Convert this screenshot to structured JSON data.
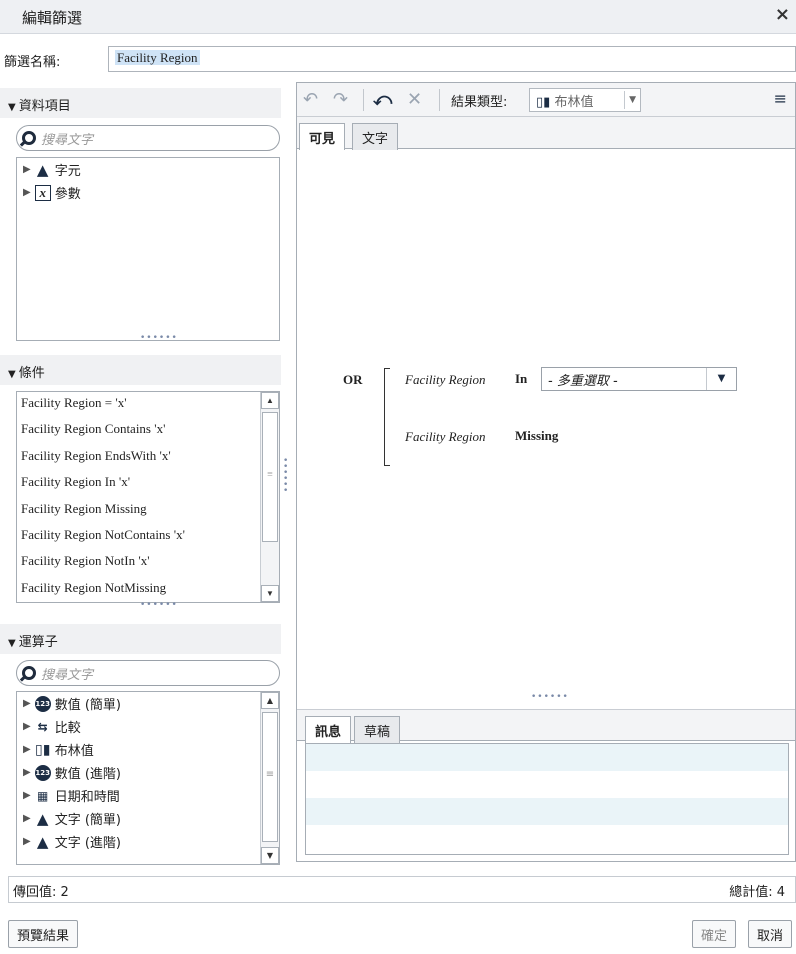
{
  "dialog": {
    "title": "編輯篩選",
    "close_glyph": "×"
  },
  "filter_name": {
    "label": "篩選名稱:",
    "value": "Facility Region"
  },
  "data_items": {
    "header": "資料項目",
    "search_placeholder": "搜尋文字",
    "items": [
      {
        "label": "字元",
        "icon": "character-icon"
      },
      {
        "label": "參數",
        "icon": "parameter-icon"
      }
    ]
  },
  "conditions": {
    "header": "條件",
    "items": [
      "Facility Region = 'x'",
      "Facility Region Contains 'x'",
      "Facility Region EndsWith 'x'",
      "Facility Region In 'x'",
      "Facility Region Missing",
      "Facility Region NotContains 'x'",
      "Facility Region NotIn 'x'",
      "Facility Region NotMissing"
    ]
  },
  "operators": {
    "header": "運算子",
    "search_placeholder": "搜尋文字",
    "items": [
      {
        "label": "數值 (簡單)",
        "icon": "numeric-icon"
      },
      {
        "label": "比較",
        "icon": "comparison-icon"
      },
      {
        "label": "布林值",
        "icon": "boolean-icon"
      },
      {
        "label": "數值 (進階)",
        "icon": "numeric-icon"
      },
      {
        "label": "日期和時間",
        "icon": "calendar-icon"
      },
      {
        "label": "文字 (簡單)",
        "icon": "character-icon"
      },
      {
        "label": "文字 (進階)",
        "icon": "character-icon"
      }
    ]
  },
  "toolbar": {
    "result_type_label": "結果類型:",
    "result_type_value": "布林值"
  },
  "editor_tabs": [
    "可見",
    "文字"
  ],
  "expression": {
    "operator": "OR",
    "row1": {
      "field": "Facility Region",
      "op": "In",
      "select_value": "- 多重選取 -"
    },
    "row2": {
      "field": "Facility Region",
      "op": "Missing"
    }
  },
  "message_tabs": [
    "訊息",
    "草稿"
  ],
  "status": {
    "returned_label": "傳回值:",
    "returned_value": "2",
    "total_label": "總計值:",
    "total_value": "4"
  },
  "buttons": {
    "preview": "預覽結果",
    "ok": "確定",
    "cancel": "取消"
  },
  "colors": {
    "accent_dark": "#1c2d44",
    "selection": "#cfe3f6",
    "alt_row": "#eaf4f8"
  }
}
